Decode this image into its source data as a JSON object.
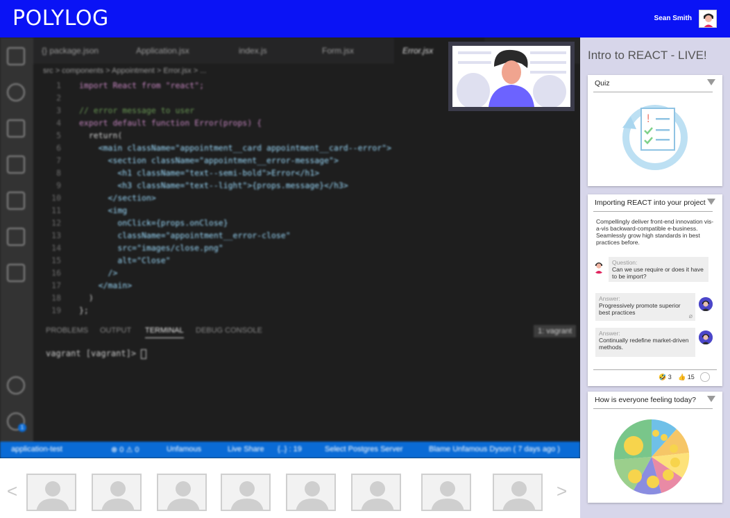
{
  "header": {
    "brand": "POLYLOG",
    "user_name": "Sean Smith"
  },
  "editor": {
    "tabs": [
      {
        "label": "{} package.json"
      },
      {
        "label": "Application.jsx"
      },
      {
        "label": "index.js"
      },
      {
        "label": "Form.jsx"
      },
      {
        "label": "Error.jsx"
      }
    ],
    "breadcrumb": "src > components > Appointment > Error.jsx > ...",
    "code_lines": [
      {
        "n": "1",
        "text": "import React from \"react\";"
      },
      {
        "n": "2",
        "text": ""
      },
      {
        "n": "3",
        "text": "// error message to user"
      },
      {
        "n": "4",
        "text": "export default function Error(props) {"
      },
      {
        "n": "5",
        "text": "  return("
      },
      {
        "n": "6",
        "text": "    <main className=\"appointment__card appointment__card--error\">"
      },
      {
        "n": "7",
        "text": "      <section className=\"appointment__error-message\">"
      },
      {
        "n": "8",
        "text": "        <h1 className=\"text--semi-bold\">Error</h1>"
      },
      {
        "n": "9",
        "text": "        <h3 className=\"text--light\">{props.message}</h3>"
      },
      {
        "n": "10",
        "text": "      </section>"
      },
      {
        "n": "11",
        "text": "      <img"
      },
      {
        "n": "12",
        "text": "        onClick={props.onClose}"
      },
      {
        "n": "13",
        "text": "        className=\"appointment__error-close\""
      },
      {
        "n": "14",
        "text": "        src=\"images/close.png\""
      },
      {
        "n": "15",
        "text": "        alt=\"Close\""
      },
      {
        "n": "16",
        "text": "      />"
      },
      {
        "n": "17",
        "text": "    </main>"
      },
      {
        "n": "18",
        "text": "  )"
      },
      {
        "n": "19",
        "text": "};"
      }
    ],
    "panel_tabs": [
      "PROBLEMS",
      "OUTPUT",
      "TERMINAL",
      "DEBUG CONSOLE"
    ],
    "terminal_select": "1: vagrant",
    "terminal_prompt": "vagrant [vagrant]> ",
    "status": {
      "branch": "application-test",
      "problems": "⊗ 0 ⚠ 0",
      "user": "Unfamous",
      "liveshare": "Live Share",
      "position": "{..} : 19",
      "server": "Select Postgres Server",
      "blame": "Blame Unfamous Dyson ( 7 days ago )"
    }
  },
  "side": {
    "title": "Intro to REACT - LIVE!",
    "quiz": {
      "title": "Quiz"
    },
    "lesson": {
      "title": "Importing REACT into your project",
      "description": "Compellingly deliver front-end innovation vis-a-vis backward-compatible e-business. Seamlessly grow high standards in best practices before.",
      "question_label": "Question:",
      "question": "Can we use require or does it have to be import?",
      "answers": [
        {
          "label": "Answer:",
          "text": "Progressively promote superior best practices"
        },
        {
          "label": "Answer:",
          "text": "Continually redefine market-driven methods."
        }
      ],
      "reaction_counts": {
        "laugh": "3",
        "thumbs": "15"
      }
    },
    "feeling": {
      "title": "How is everyone feeling today?"
    }
  },
  "colors": {
    "topbar": "#0a13f5",
    "statusbar": "#0a6bd6",
    "side": "#d7d6ea",
    "pie": [
      "#9bcf8c",
      "#5ab0e3",
      "#8a8de0",
      "#e98aa5",
      "#f6c667",
      "#fde27a",
      "#c3e083"
    ]
  }
}
